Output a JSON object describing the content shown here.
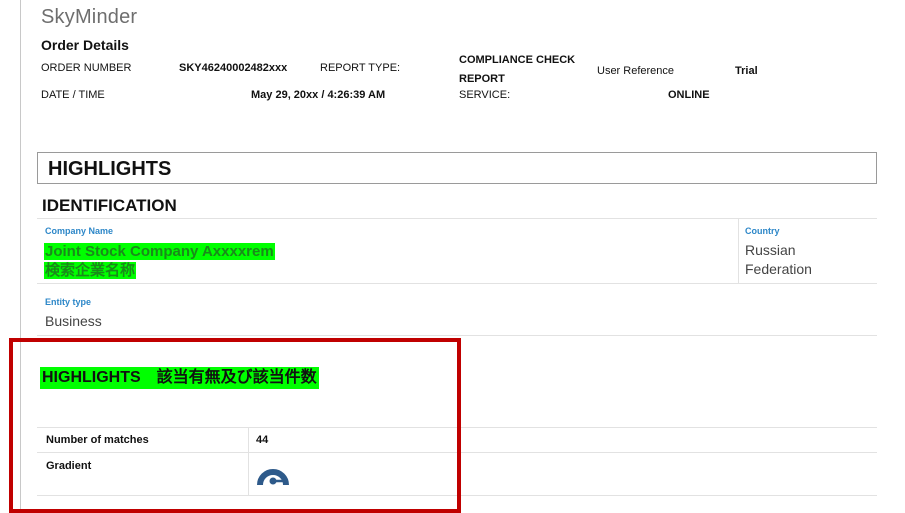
{
  "brand": "SkyMinder",
  "order_details": {
    "title": "Order Details",
    "order_number_label": "ORDER NUMBER",
    "order_number_value": "SKY46240002482xxx",
    "report_type_label": "REPORT TYPE:",
    "report_type_value_line1": "COMPLIANCE CHECK",
    "report_type_value_line2": "REPORT",
    "user_reference_label": "User Reference",
    "user_reference_value": "Trial",
    "date_time_label": "DATE / TIME",
    "date_time_value": "May 29, 20xx / 4:26:39 AM",
    "service_label": "SERVICE:",
    "service_value": "ONLINE"
  },
  "highlights_header": "HIGHLIGHTS",
  "identification": {
    "title": "IDENTIFICATION",
    "company_name_label": "Company Name",
    "company_name_value": "Joint Stock Company Axxxxrem",
    "company_name_note": "検索企業名称",
    "country_label": "Country",
    "country_value_line1": "Russian",
    "country_value_line2": "Federation",
    "entity_type_label": "Entity type",
    "entity_type_value": "Business"
  },
  "highlights_section": {
    "title": "HIGHLIGHTS　該当有無及び該当件数",
    "number_of_matches_label": "Number of matches",
    "number_of_matches_value": "44",
    "gradient_label": "Gradient",
    "gradient_icon": "gauge-icon",
    "gauge_color": "#2e5a8a"
  },
  "colors": {
    "highlight_green": "#00ff00",
    "annotation_red": "#c00000",
    "label_blue": "#2d87c8"
  }
}
